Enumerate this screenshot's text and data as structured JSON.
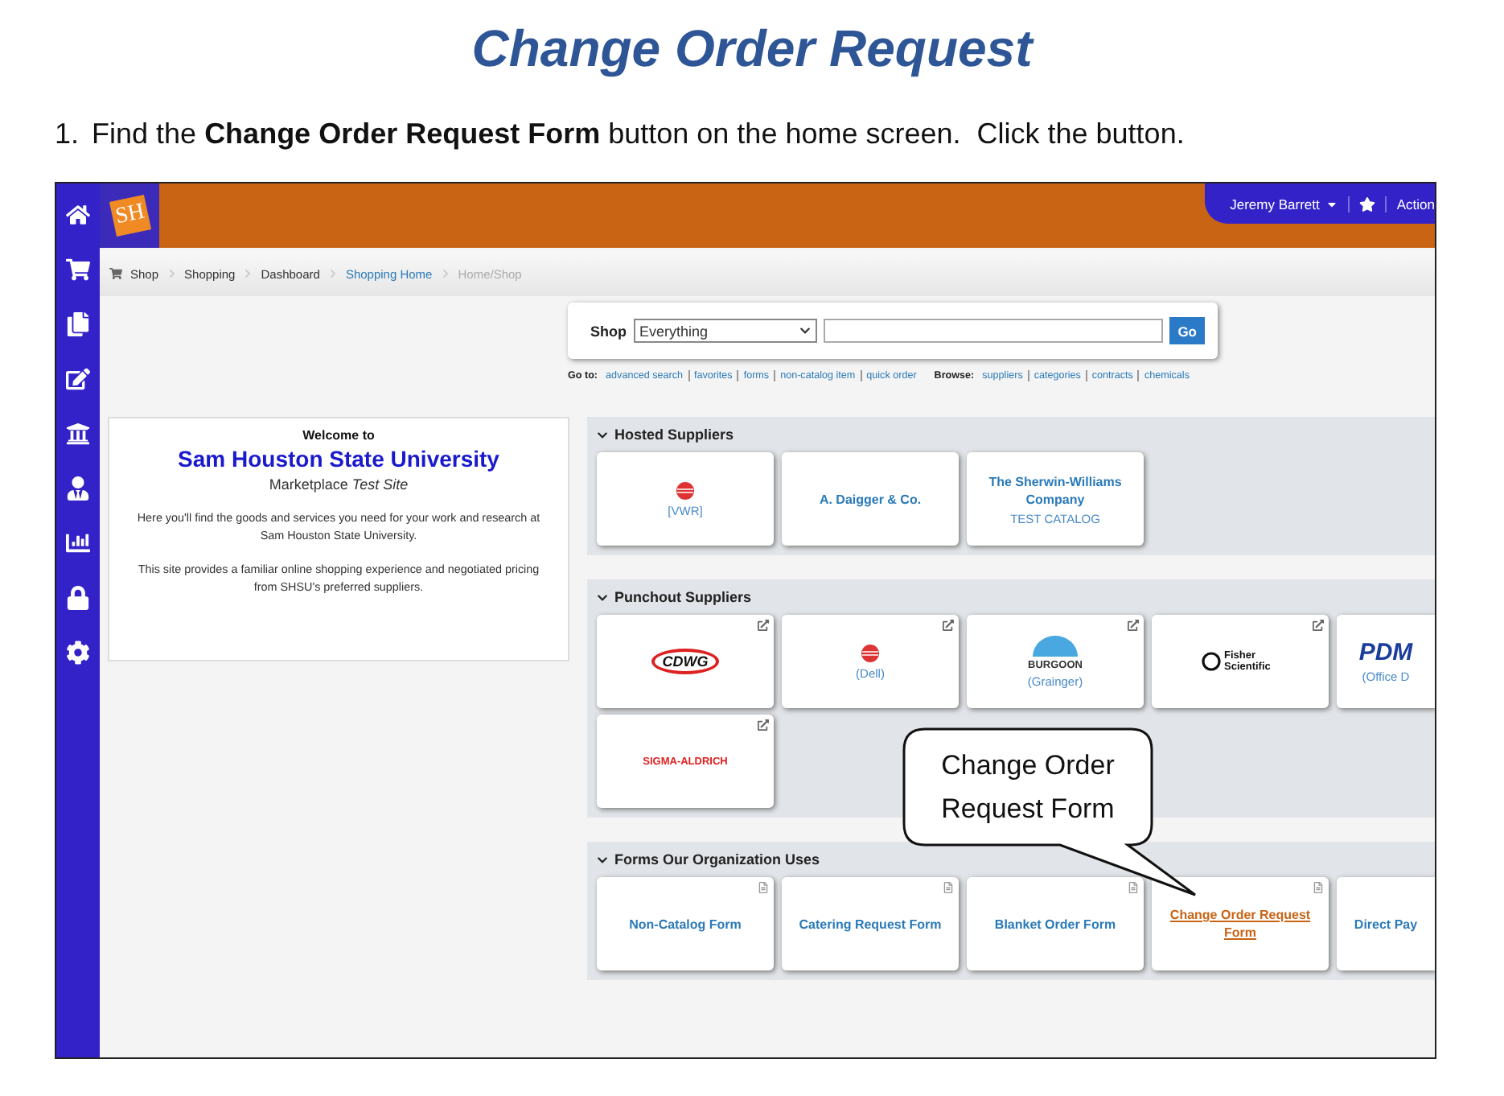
{
  "title": "Change Order Request",
  "instruction": {
    "number": "1.",
    "text": "Find the **Change Order Request Form** button on the home screen.  Click the button."
  },
  "app": {
    "logo_text": "SH",
    "user_menu": {
      "name": "Jeremy Barrett",
      "action": "Action"
    },
    "breadcrumbs": [
      {
        "label": "Shop",
        "kind": "plain"
      },
      {
        "label": "Shopping",
        "kind": "plain"
      },
      {
        "label": "Dashboard",
        "kind": "plain"
      },
      {
        "label": "Shopping Home",
        "kind": "link"
      },
      {
        "label": "Home/Shop",
        "kind": "current"
      }
    ],
    "search": {
      "label": "Shop",
      "scope": "Everything",
      "button": "Go"
    },
    "goto": {
      "label": "Go to:",
      "links": [
        "advanced search",
        "favorites",
        "forms",
        "non-catalog item",
        "quick order"
      ]
    },
    "browse": {
      "label": "Browse:",
      "links": [
        "suppliers",
        "categories",
        "contracts",
        "chemicals"
      ]
    },
    "welcome": {
      "heading": "Welcome to",
      "name": "Sam Houston State University",
      "subtitle": "Marketplace *Test Site*",
      "paragraphs": [
        "Here you'll find the goods and services you need for your work and research at Sam Houston State University.",
        "This site provides a familiar online shopping experience and negotiated pricing from SHSU's preferred suppliers."
      ]
    },
    "sections": [
      {
        "title": "Hosted Suppliers",
        "rows": [
          [
            {
              "kind": "hosted",
              "logo": {
                "kind": "sphere"
              },
              "caption": "[VWR]"
            },
            {
              "kind": "hosted",
              "name": "A. Daigger & Co."
            },
            {
              "kind": "hosted",
              "name": "The Sherwin-Williams Company",
              "caption": "TEST CATALOG"
            }
          ]
        ]
      },
      {
        "title": "Punchout Suppliers",
        "rows": [
          [
            {
              "kind": "punchout",
              "logo": {
                "kind": "cdw",
                "text": "CDWG"
              }
            },
            {
              "kind": "punchout",
              "logo": {
                "kind": "sphere"
              },
              "caption": "(Dell)"
            },
            {
              "kind": "punchout",
              "logo": {
                "kind": "dome",
                "text": "BURGOON"
              },
              "caption": "(Grainger)"
            },
            {
              "kind": "punchout",
              "logo": {
                "kind": "fisher",
                "text": "Fisher Scientific"
              }
            },
            {
              "logo": {
                "kind": "pdm",
                "text": "PDM"
              },
              "caption": "(Office D",
              "partial": true
            }
          ],
          [
            {
              "kind": "punchout",
              "logo": {
                "kind": "sigma",
                "text": "SIGMA-ALDRICH"
              }
            }
          ]
        ]
      },
      {
        "title": "Forms Our Organization Uses",
        "rows": [
          [
            {
              "kind": "form",
              "name": "Non-Catalog Form",
              "highlighted": false
            },
            {
              "kind": "form",
              "name": "Catering Request Form",
              "highlighted": false
            },
            {
              "kind": "form",
              "name": "Blanket Order Form",
              "highlighted": false
            },
            {
              "kind": "form",
              "name": "Change Order Request Form",
              "highlighted": true
            },
            {
              "name": "Direct Pay",
              "highlighted": false,
              "partial": true
            }
          ]
        ]
      }
    ]
  },
  "callout": [
    "Change Order",
    "Request Form"
  ]
}
